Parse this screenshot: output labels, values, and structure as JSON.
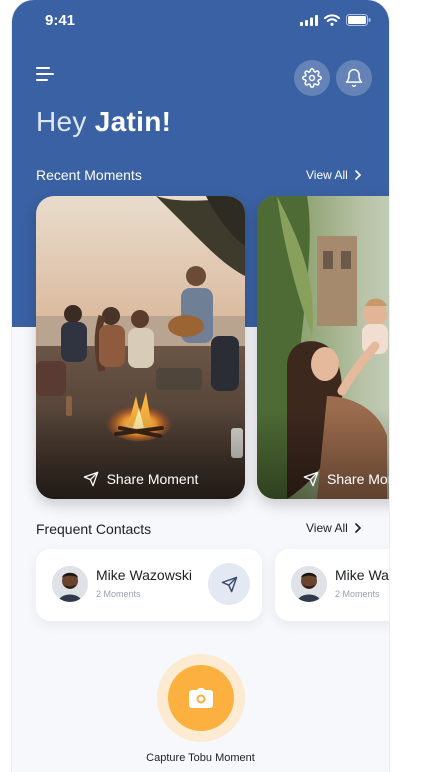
{
  "status_bar": {
    "time": "9:41",
    "icons": [
      "signal-icon",
      "wifi-icon",
      "battery-icon"
    ]
  },
  "header": {
    "menu_icon": "menu-icon",
    "settings_icon": "gear-icon",
    "notifications_icon": "bell-icon",
    "greeting_prefix": "Hey",
    "user_name": "Jatin!"
  },
  "recent_moments": {
    "title": "Recent Moments",
    "view_all": "View All",
    "cards": [
      {
        "share_label": "Share Moment"
      },
      {
        "share_label": "Share Moment"
      }
    ]
  },
  "frequent_contacts": {
    "title": "Frequent Contacts",
    "view_all": "View All",
    "contacts": [
      {
        "name": "Mike Wazowski",
        "moments": "2 Moments"
      },
      {
        "name": "Mike Wazowski",
        "moments": "2 Moments"
      }
    ]
  },
  "capture": {
    "label": "Capture Tobu Moment",
    "icon": "camera-icon"
  },
  "colors": {
    "primary": "#3a61a3",
    "accent": "#fbb03f",
    "accent_soft": "#fdebd1",
    "background": "#f7f8fb"
  }
}
